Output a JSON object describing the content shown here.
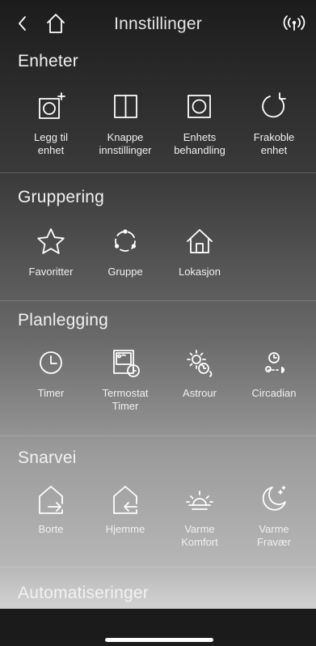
{
  "header": {
    "title": "Innstillinger"
  },
  "sections": [
    {
      "title": "Enheter",
      "items": [
        {
          "label": "Legg til\nenhet",
          "icon": "add-device-icon"
        },
        {
          "label": "Knappe\ninnstillinger",
          "icon": "button-settings-icon"
        },
        {
          "label": "Enhets\nbehandling",
          "icon": "device-management-icon"
        },
        {
          "label": "Frakoble\nenhet",
          "icon": "disconnect-icon"
        }
      ]
    },
    {
      "title": "Gruppering",
      "items": [
        {
          "label": "Favoritter",
          "icon": "star-icon"
        },
        {
          "label": "Gruppe",
          "icon": "group-icon"
        },
        {
          "label": "Lokasjon",
          "icon": "house-icon"
        }
      ]
    },
    {
      "title": "Planlegging",
      "items": [
        {
          "label": "Timer",
          "icon": "clock-icon"
        },
        {
          "label": "Termostat\nTimer",
          "icon": "thermostat-timer-icon"
        },
        {
          "label": "Astrour",
          "icon": "astro-icon"
        },
        {
          "label": "Circadian",
          "icon": "circadian-icon"
        }
      ]
    },
    {
      "title": "Snarvei",
      "items": [
        {
          "label": "Borte",
          "icon": "leave-home-icon"
        },
        {
          "label": "Hjemme",
          "icon": "arrive-home-icon"
        },
        {
          "label": "Varme\nKomfort",
          "icon": "sunrise-icon"
        },
        {
          "label": "Varme\nFravær",
          "icon": "moon-icon"
        }
      ]
    },
    {
      "title": "Automatiseringer",
      "items": []
    }
  ]
}
